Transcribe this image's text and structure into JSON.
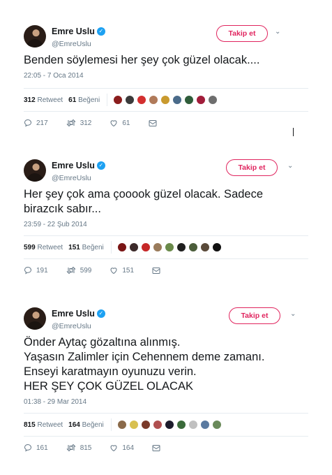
{
  "tweets": [
    {
      "author": {
        "name": "Emre Uslu",
        "handle": "@EmreUslu"
      },
      "follow_label": "Takip et",
      "text_lines": [
        "Benden söylemesi her şey çok güzel olacak...."
      ],
      "timestamp": "22:05 - 7 Oca 2014",
      "retweets": "312",
      "retweets_label": "Retweet",
      "likes": "61",
      "likes_label": "Beğeni",
      "actions": {
        "reply": "217",
        "retweet": "312",
        "like": "61"
      },
      "face_colors": [
        "#8b1d1d",
        "#3b3b3b",
        "#d32f2f",
        "#b07a5a",
        "#c99a2e",
        "#4a6b8a",
        "#2f5d3a",
        "#a11d3a",
        "#6e6e6e"
      ]
    },
    {
      "author": {
        "name": "Emre Uslu",
        "handle": "@EmreUslu"
      },
      "follow_label": "Takip et",
      "text_lines": [
        "Her şey çok ama çooook güzel olacak. Sadece",
        "birazcık sabır..."
      ],
      "timestamp": "23:59 - 22 Şub 2014",
      "retweets": "599",
      "retweets_label": "Retweet",
      "likes": "151",
      "likes_label": "Beğeni",
      "actions": {
        "reply": "191",
        "retweet": "599",
        "like": "151"
      },
      "face_colors": [
        "#7a1515",
        "#3c2a2a",
        "#c62828",
        "#9a7b5b",
        "#6a8a4a",
        "#1f1f1f",
        "#4b5d3a",
        "#5a4a3a",
        "#111111"
      ]
    },
    {
      "author": {
        "name": "Emre Uslu",
        "handle": "@EmreUslu"
      },
      "follow_label": "Takip et",
      "text_lines": [
        "Önder Aytaç gözaltına alınmış.",
        "Yaşasın Zalimler için Cehennem deme zamanı.",
        "Enseyi karatmayın oyunuzu verin.",
        "HER ŞEY ÇOK GÜZEL OLACAK"
      ],
      "timestamp": "01:38 - 29 Mar 2014",
      "retweets": "815",
      "retweets_label": "Retweet",
      "likes": "164",
      "likes_label": "Beğeni",
      "actions": {
        "reply": "161",
        "retweet": "815",
        "like": "164"
      },
      "face_colors": [
        "#8a6a4a",
        "#d8c050",
        "#7a3a2a",
        "#b05050",
        "#1c1c2c",
        "#3a6a3a",
        "#c0c0c0",
        "#5a7aa0",
        "#6a8a5a"
      ]
    }
  ],
  "colors": {
    "accent_follow": "#e0245e",
    "verified": "#1da1f2",
    "meta_gray": "#657786"
  },
  "icons": {
    "verified": "verified-badge-icon",
    "chevron": "chevron-down-icon",
    "reply": "reply-icon",
    "retweet": "retweet-icon",
    "like": "heart-icon",
    "dm": "envelope-icon"
  }
}
